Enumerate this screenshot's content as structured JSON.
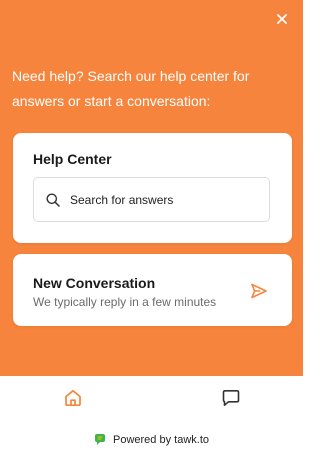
{
  "widget": {
    "close_icon": "close-icon",
    "intro_text": "Need help? Search our help center for answers or start a conversation:",
    "help_center": {
      "title": "Help Center",
      "search_placeholder": "Search for answers",
      "search_icon": "search-icon"
    },
    "new_conversation": {
      "title": "New Conversation",
      "subtitle": "We typically reply in a few minutes",
      "icon": "send-icon"
    },
    "nav": {
      "home_icon": "home-icon",
      "chat_icon": "chat-icon"
    },
    "footer": {
      "powered_by": "Powered by tawk.to",
      "logo_icon": "tawk-logo-icon"
    }
  },
  "colors": {
    "brand_orange": "#f7843c",
    "white": "#ffffff",
    "text_dark": "#1a1a1a",
    "text_muted": "#6b6b6b"
  }
}
